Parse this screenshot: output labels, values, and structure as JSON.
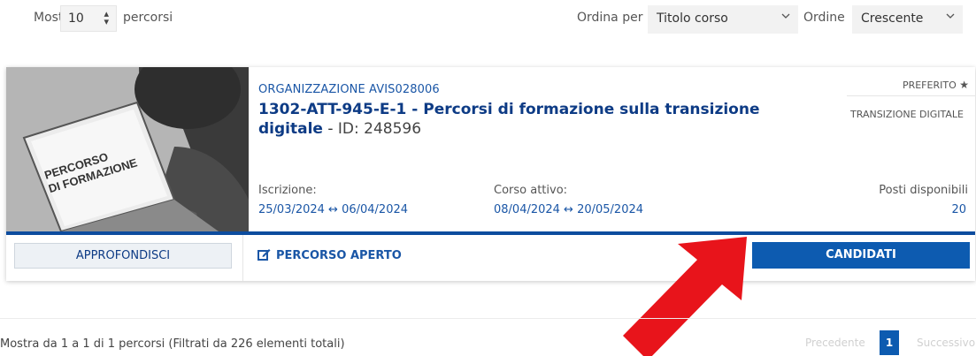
{
  "list_controls": {
    "show_label": "Mostra",
    "page_size": "10",
    "show_suffix": "percorsi",
    "order_by_label": "Ordina per",
    "order_by_value": "Titolo corso",
    "order_label": "Ordine",
    "order_value": "Crescente"
  },
  "course": {
    "image_text_line1": "PERCORSO",
    "image_text_line2": "DI FORMAZIONE",
    "organization": "ORGANIZZAZIONE AVIS028006",
    "title": "1302-ATT-945-E-1 - Percorsi di formazione sulla transizione digitale",
    "title_separator": " - ",
    "id_label": "ID: ",
    "id_value": "248596",
    "favorite_label": "PREFERITO",
    "category": "TRANSIZIONE DIGITALE",
    "enrollment_label": "Iscrizione:",
    "enrollment_dates": "25/03/2024 ↔ 06/04/2024",
    "active_label": "Corso attivo:",
    "active_dates": "08/04/2024 ↔ 20/05/2024",
    "seats_label": "Posti disponibili",
    "seats_value": "20",
    "learn_more_label": "APPROFONDISCI",
    "open_path_label": "PERCORSO APERTO",
    "apply_label": "CANDIDATI"
  },
  "footer": {
    "info": "Mostra da 1 a 1 di 1 percorsi (Filtrati da 226 elementi totali)",
    "prev_label": "Precedente",
    "current_page": "1",
    "next_label": "Successivo"
  },
  "colors": {
    "primary": "#0d5bb0",
    "title_blue": "#0d3b85",
    "link_blue": "#1a56a6",
    "annotation_arrow": "#e8141b"
  },
  "icons": [
    "sort-arrows-icon",
    "chevron-down-icon",
    "star-icon",
    "edit-icon",
    "arrow-pointer-icon"
  ]
}
